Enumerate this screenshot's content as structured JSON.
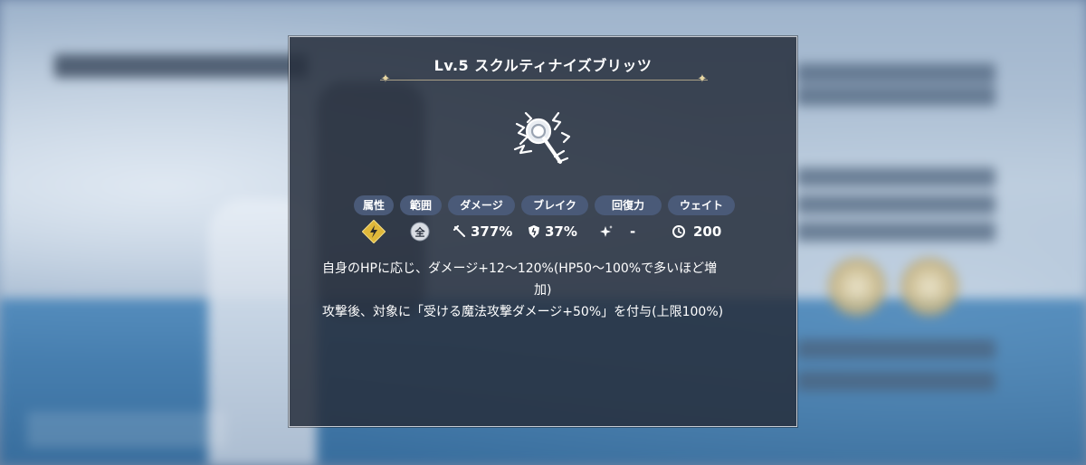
{
  "skill": {
    "title": "Lv.5 スクルティナイズブリッツ",
    "icon": "lightning-staff-icon"
  },
  "stats": {
    "labels": {
      "attribute": "属性",
      "range": "範囲",
      "damage": "ダメージ",
      "break": "ブレイク",
      "recovery": "回復力",
      "wait": "ウェイト"
    },
    "values": {
      "attribute_icon": "lightning-element-icon",
      "range": "全",
      "damage": "377%",
      "break": "37%",
      "recovery": "-",
      "wait": "200"
    }
  },
  "description": {
    "line1": "自身のHPに応じ、ダメージ+12～120%(HP50～100%で多いほど増",
    "line2": "加)",
    "line3": "攻撃後、対象に「受ける魔法攻撃ダメージ+50%」を付与(上限100%)"
  },
  "colors": {
    "modal_bg": "#262e3c",
    "pill_bg": "#4a5a78",
    "accent_gold": "#e0b83a",
    "divider": "#a89f86"
  }
}
